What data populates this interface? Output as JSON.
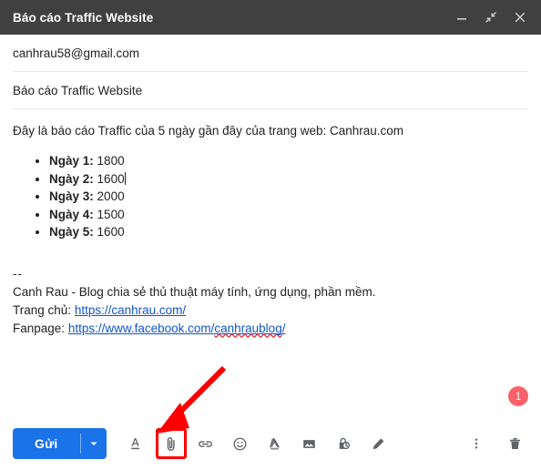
{
  "window": {
    "title": "Báo cáo Traffic Website",
    "controls": [
      {
        "name": "minimize-icon",
        "label": "Minimize"
      },
      {
        "name": "exit-fullscreen-icon",
        "label": "Exit full screen"
      },
      {
        "name": "close-icon",
        "label": "Close"
      }
    ]
  },
  "fields": {
    "to": "canhrau58@gmail.com",
    "subject": "Báo cáo Traffic Website"
  },
  "body": {
    "intro": "Đây là báo cáo Traffic của 5 ngày gần đây của trang web: Canhrau.com",
    "list": [
      {
        "label": "Ngày 1:",
        "value": "1800",
        "caret": false
      },
      {
        "label": "Ngày 2:",
        "value": "1600",
        "caret": true
      },
      {
        "label": "Ngày 3:",
        "value": "2000",
        "caret": false
      },
      {
        "label": "Ngày 4:",
        "value": "1500",
        "caret": false
      },
      {
        "label": "Ngày 5:",
        "value": "1600",
        "caret": false
      }
    ],
    "signature": {
      "separator": "--",
      "tagline": "Canh Rau - Blog chia sẻ thủ thuật máy tính, ứng dụng, phần mềm.",
      "home_label": "Trang chủ:",
      "home_url": "https://canhrau.com/",
      "fanpage_label": "Fanpage:",
      "fanpage_url_prefix": "https://www.facebook.com/",
      "fanpage_url_misspelled": "canhraublog",
      "fanpage_url_suffix": "/"
    }
  },
  "badge": {
    "count": "1"
  },
  "toolbar": {
    "send_label": "Gửi",
    "send_caret": "caret-down-icon",
    "icons": [
      {
        "name": "formatting-options-icon",
        "label": "Formatting options"
      },
      {
        "name": "attach-file-icon",
        "label": "Attach files"
      },
      {
        "name": "insert-link-icon",
        "label": "Insert link"
      },
      {
        "name": "insert-emoji-icon",
        "label": "Insert emoji"
      },
      {
        "name": "insert-drive-icon",
        "label": "Insert files using Drive"
      },
      {
        "name": "insert-photo-icon",
        "label": "Insert photo"
      },
      {
        "name": "confidential-mode-icon",
        "label": "Toggle confidential mode"
      },
      {
        "name": "insert-signature-icon",
        "label": "Insert signature"
      }
    ],
    "more_options": "More options",
    "discard": "Discard draft"
  },
  "colors": {
    "titlebar": "#404040",
    "send_blue": "#1a73e8",
    "link_blue": "#1155cc",
    "badge_red": "#f9606a",
    "annotation_red": "#ff0000",
    "icon_gray": "#5f6368"
  }
}
